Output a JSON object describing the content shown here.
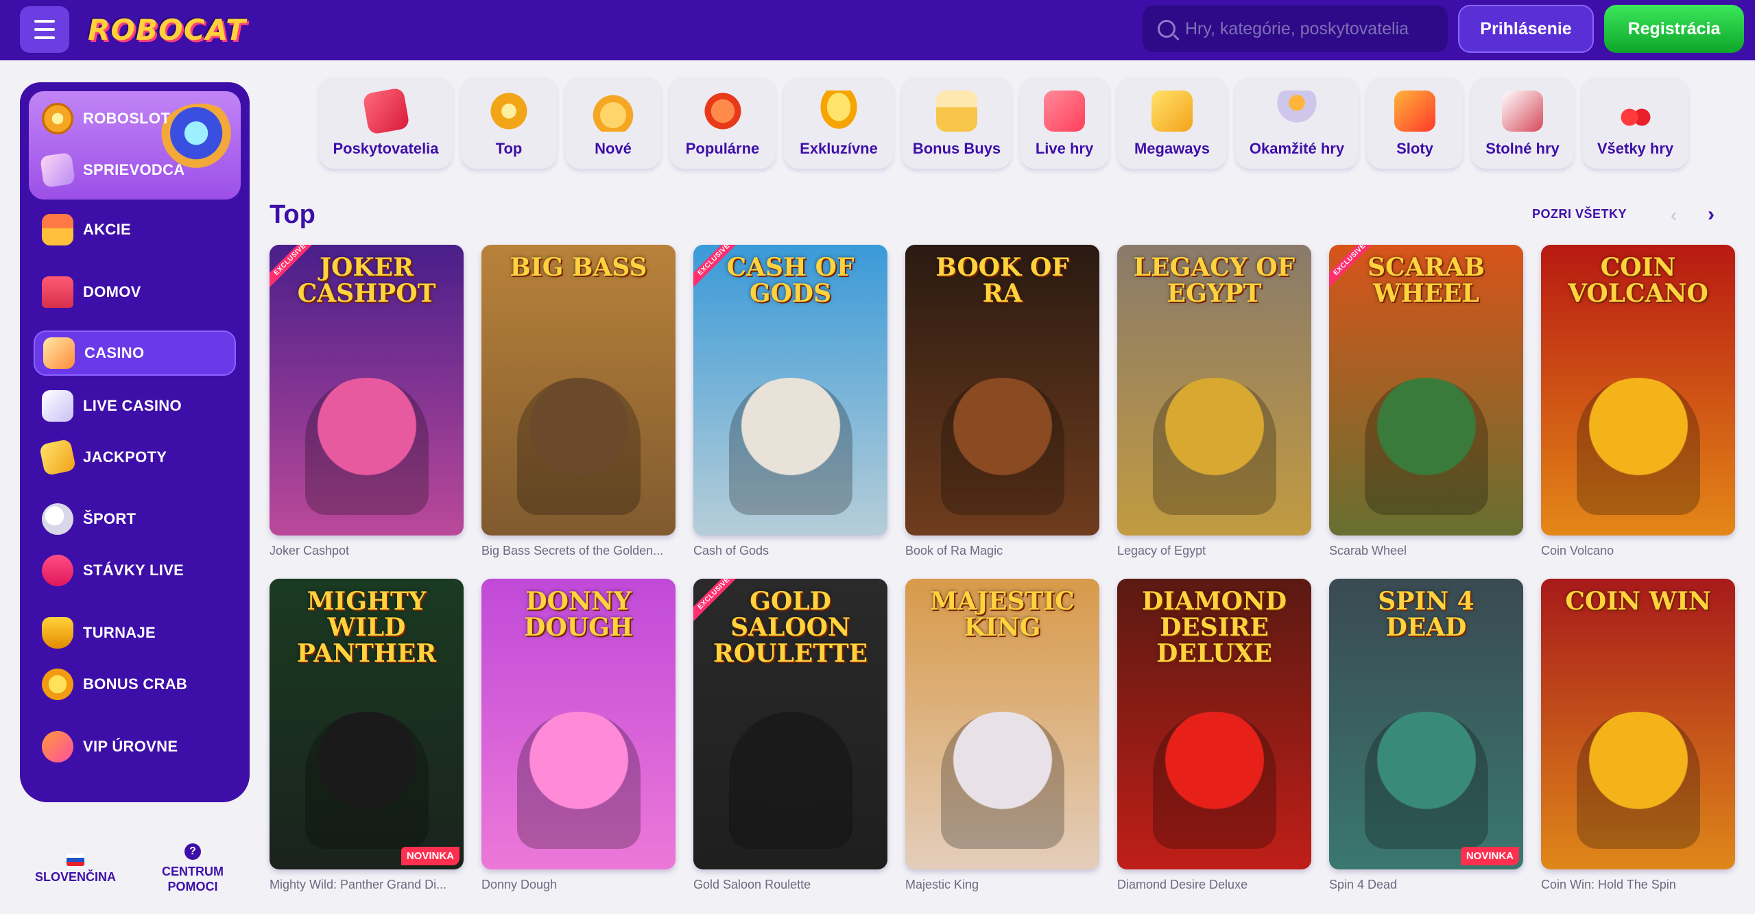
{
  "header": {
    "search_placeholder": "Hry, kategórie, poskytovatelia",
    "login_label": "Prihlásenie",
    "register_label": "Registrácia",
    "logo_text": "ROBOCAT"
  },
  "sidebar": {
    "promo_items": [
      {
        "label": "ROBOSLOT",
        "icon": "roboslot-icon"
      },
      {
        "label": "SPRIEVODCA",
        "icon": "guide-icon"
      }
    ],
    "items": [
      {
        "label": "AKCIE",
        "icon": "gift-icon"
      },
      {
        "label": "DOMOV",
        "icon": "home-icon"
      },
      {
        "label": "CASINO",
        "icon": "casino-icon",
        "active": true
      },
      {
        "label": "LIVE CASINO",
        "icon": "live-casino-icon"
      },
      {
        "label": "JACKPOTY",
        "icon": "jackpot-icon"
      },
      {
        "label": "ŠPORT",
        "icon": "sport-icon"
      },
      {
        "label": "STÁVKY LIVE",
        "icon": "live-bets-icon"
      },
      {
        "label": "TURNAJE",
        "icon": "trophy-icon"
      },
      {
        "label": "BONUS CRAB",
        "icon": "bonus-crab-icon"
      },
      {
        "label": "VIP ÚROVNE",
        "icon": "vip-icon"
      }
    ],
    "language": "SLOVENČINA",
    "help_line1": "CENTRUM",
    "help_line2": "POMOCI",
    "help_glyph": "?"
  },
  "categories": [
    {
      "label": "Poskytovatelia",
      "color": "#e8384f"
    },
    {
      "label": "Top",
      "color": "#f2a516"
    },
    {
      "label": "Nové",
      "color": "#f5a623"
    },
    {
      "label": "Populárne",
      "color": "#f04a2a"
    },
    {
      "label": "Exkluzívne",
      "color": "#f5b400"
    },
    {
      "label": "Bonus Buys",
      "color": "#f7c64a"
    },
    {
      "label": "Live hry",
      "color": "#ff4f6a"
    },
    {
      "label": "Megaways",
      "color": "#f5b82a"
    },
    {
      "label": "Okamžité hry",
      "color": "#b0a4d8"
    },
    {
      "label": "Sloty",
      "color": "#ff5a3a"
    },
    {
      "label": "Stolné hry",
      "color": "#d64a5a"
    },
    {
      "label": "Všetky hry",
      "color": "#e8303a"
    }
  ],
  "section": {
    "title": "Top",
    "see_all": "POZRI VŠETKY",
    "prev_glyph": "‹",
    "next_glyph": "›"
  },
  "games": [
    {
      "name": "Joker Cashpot",
      "art": "JOKER CASHPOT",
      "bg": "#4a1f8a",
      "accent": "#e85aa0",
      "exclusive": true,
      "novinka": false
    },
    {
      "name": "Big Bass Secrets of the Golden...",
      "art": "BIG BASS",
      "bg": "#b8823a",
      "accent": "#6a4a2a",
      "exclusive": false,
      "novinka": false
    },
    {
      "name": "Cash of Gods",
      "art": "CASH OF GODS",
      "bg": "#3a9ad8",
      "accent": "#e8e2d8",
      "exclusive": true,
      "novinka": false
    },
    {
      "name": "Book of Ra Magic",
      "art": "BOOK OF RA",
      "bg": "#2a1a12",
      "accent": "#8a4a22",
      "exclusive": false,
      "novinka": false
    },
    {
      "name": "Legacy of Egypt",
      "art": "LEGACY OF EGYPT",
      "bg": "#8a7a6a",
      "accent": "#d8a830",
      "exclusive": false,
      "novinka": false
    },
    {
      "name": "Scarab Wheel",
      "art": "SCARAB WHEEL",
      "bg": "#d8541a",
      "accent": "#3a7a3a",
      "exclusive": true,
      "novinka": false
    },
    {
      "name": "Coin Volcano",
      "art": "COIN VOLCANO",
      "bg": "#b81a12",
      "accent": "#f5b31a",
      "exclusive": false,
      "novinka": false
    },
    {
      "name": "Mighty Wild: Panther Grand Di...",
      "art": "MIGHTY WILD PANTHER",
      "bg": "#1a3a22",
      "accent": "#1a1a1a",
      "exclusive": false,
      "novinka": true
    },
    {
      "name": "Donny Dough",
      "art": "DONNY DOUGH",
      "bg": "#c04ad8",
      "accent": "#ff8ad8",
      "exclusive": false,
      "novinka": false
    },
    {
      "name": "Gold Saloon Roulette",
      "art": "GOLD SALOON ROULETTE",
      "bg": "#2a2a2a",
      "accent": "#1a1a1a",
      "exclusive": true,
      "novinka": false
    },
    {
      "name": "Majestic King",
      "art": "MAJESTIC KING",
      "bg": "#d89a4a",
      "accent": "#e8e2e8",
      "exclusive": false,
      "novinka": false
    },
    {
      "name": "Diamond Desire Deluxe",
      "art": "DIAMOND DESIRE DELUXE",
      "bg": "#5a1a12",
      "accent": "#e8201a",
      "exclusive": false,
      "novinka": false
    },
    {
      "name": "Spin 4 Dead",
      "art": "SPIN 4 DEAD",
      "bg": "#3a4a52",
      "accent": "#3a8a7a",
      "exclusive": false,
      "novinka": true
    },
    {
      "name": "Coin Win: Hold The Spin",
      "art": "COIN WIN",
      "bg": "#a81a1a",
      "accent": "#f5b31a",
      "exclusive": false,
      "novinka": false
    }
  ],
  "badges": {
    "exclusive": "EXCLUSIVE",
    "novinka": "NOVINKA"
  }
}
